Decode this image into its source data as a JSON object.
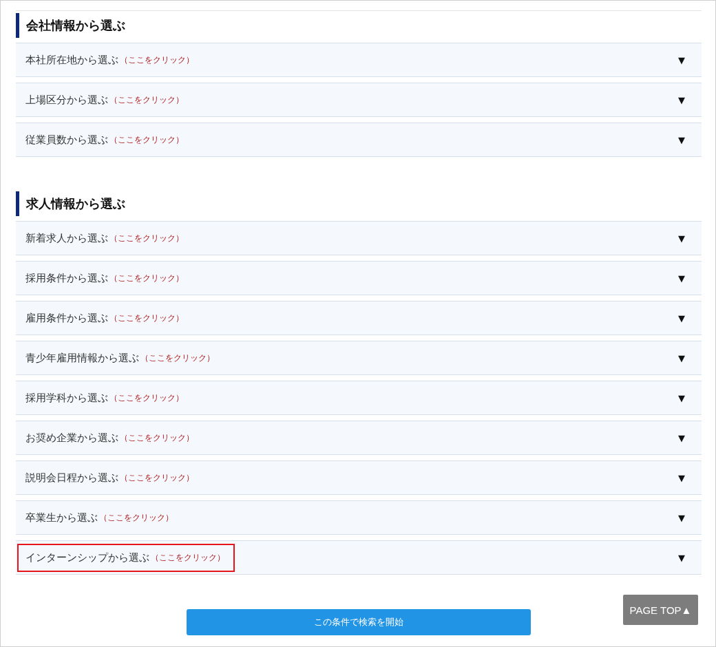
{
  "sections": [
    {
      "title": "会社情報から選ぶ",
      "items": [
        {
          "label": "本社所在地から選ぶ",
          "hint": "（ここをクリック）",
          "toggle": "▼",
          "expanded": false,
          "highlighted": false
        },
        {
          "label": "上場区分から選ぶ",
          "hint": "（ここをクリック）",
          "toggle": "▼",
          "expanded": false,
          "highlighted": false
        },
        {
          "label": "従業員数から選ぶ",
          "hint": "（ここをクリック）",
          "toggle": "▼",
          "expanded": false,
          "highlighted": false
        }
      ]
    },
    {
      "title": "求人情報から選ぶ",
      "items": [
        {
          "label": "新着求人から選ぶ",
          "hint": "（ここをクリック）",
          "toggle": "▼",
          "expanded": false,
          "highlighted": false
        },
        {
          "label": "採用条件から選ぶ",
          "hint": "（ここをクリック）",
          "toggle": "▼",
          "expanded": false,
          "highlighted": false
        },
        {
          "label": "雇用条件から選ぶ",
          "hint": "（ここをクリック）",
          "toggle": "▼",
          "expanded": false,
          "highlighted": false
        },
        {
          "label": "青少年雇用情報から選ぶ",
          "hint": "（ここをクリック）",
          "toggle": "▼",
          "expanded": false,
          "highlighted": false
        },
        {
          "label": "採用学科から選ぶ",
          "hint": "（ここをクリック）",
          "toggle": "▼",
          "expanded": false,
          "highlighted": false
        },
        {
          "label": "お奨め企業から選ぶ",
          "hint": "（ここをクリック）",
          "toggle": "▼",
          "expanded": false,
          "highlighted": false
        },
        {
          "label": "説明会日程から選ぶ",
          "hint": "（ここをクリック）",
          "toggle": "▼",
          "expanded": false,
          "highlighted": false
        },
        {
          "label": "卒業生から選ぶ",
          "hint": "（ここをクリック）",
          "toggle": "▼",
          "expanded": false,
          "highlighted": false
        },
        {
          "label": "インターンシップから選ぶ",
          "hint": "（ここをクリック）",
          "toggle": "▼",
          "expanded": false,
          "highlighted": true
        }
      ]
    }
  ],
  "search_button": "この条件で検索を開始",
  "page_top": "PAGE TOP▲"
}
